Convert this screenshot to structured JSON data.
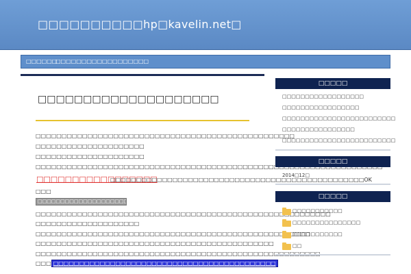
{
  "header": {
    "site_title": "□□□□□□□□□□hp□kavelin.net□"
  },
  "nav": {
    "items": [
      "□□□□□□",
      "□□□□□□□□□□□□□□□□□□"
    ]
  },
  "post": {
    "title": "□□□□□□□□□□□□□□□□□□□□",
    "lines": [
      "□□□□□□□□□□□□□□□□□□□□□□□□□□□□□□□□□□□□□□□□□□□□□□□□□□",
      "□□□□□□□□□□□□□□□□□□□□□",
      "□□□□□□□□□□□□□□□□□□□□□",
      "□□□□□□□□□□□□□□□□□□□□□□□□□□□□□□□□□□□□□□□□□□□□□□□□□□□□□□□□□□□□□□□□□□□"
    ],
    "red_link": "□□□□□□□□□□□□□□□□□",
    "after_red": "□□□□□□□□□□□□□□□□□□□□□□□□□□□□□□□□□□□□□□□□□□□□□□□□□OK",
    "after_red_2": "□□□",
    "gray_bar": "□□□□□□□□□□□□□□□□□□□□□□□□□□□",
    "lines_2": [
      "□□□□□□□□□□□□□□□□□□□□□□□□□□□□□□□□□□□□□□□□□□□□□□□□□□□□□□□□□",
      "□□□□□□□□□□□□□□□□□□□□",
      "□□□□□□□□□□□□□□□□□□□□□□□□□□□□□□□□□□□□□□□□□□□□□□□□□□□□□",
      "□□□□□□□□□□□□□□□□□□□□□□□□□□□□□□□□□□□□□□□□□□□□□□",
      "□□□□□□□□□□□□□□□□□□□□□□□□□□□□□□□□□□□□□□□□□□□□□□□□□□□□□□□"
    ],
    "blue_prefix": "□□□",
    "blue_link": "□□□□□□□□□□□□□□□□□□□□□□□□□□□□□□□□□□□□□□□□□□□"
  },
  "sidebar": {
    "recent": {
      "title": "□□□□□",
      "links": [
        "□□□□□□□□□□□□□□□□□□",
        "□□□□□□□□□□□□□□□□□",
        "□□□□□□□□□□□□□□□□□□□□□□□□□",
        "□□□□□□□□□□□□□□□□",
        "□□□□□□□□□□□□□□□□□□□□□□□□□"
      ]
    },
    "archive": {
      "title": "□□□□□",
      "items": [
        "2014□12□"
      ]
    },
    "categories": {
      "title": "□□□□□",
      "items": [
        "□□□□□□□□□□□",
        "□□□□□□□□□□□□□□□",
        "□□□□□□□□□□□",
        "□□"
      ]
    }
  },
  "colors": {
    "header": "#6f9ed6",
    "nav": "#5f8fcb",
    "widget_title": "#0f2351",
    "red_link": "#e0312f",
    "blue_link": "#2d34d9"
  }
}
